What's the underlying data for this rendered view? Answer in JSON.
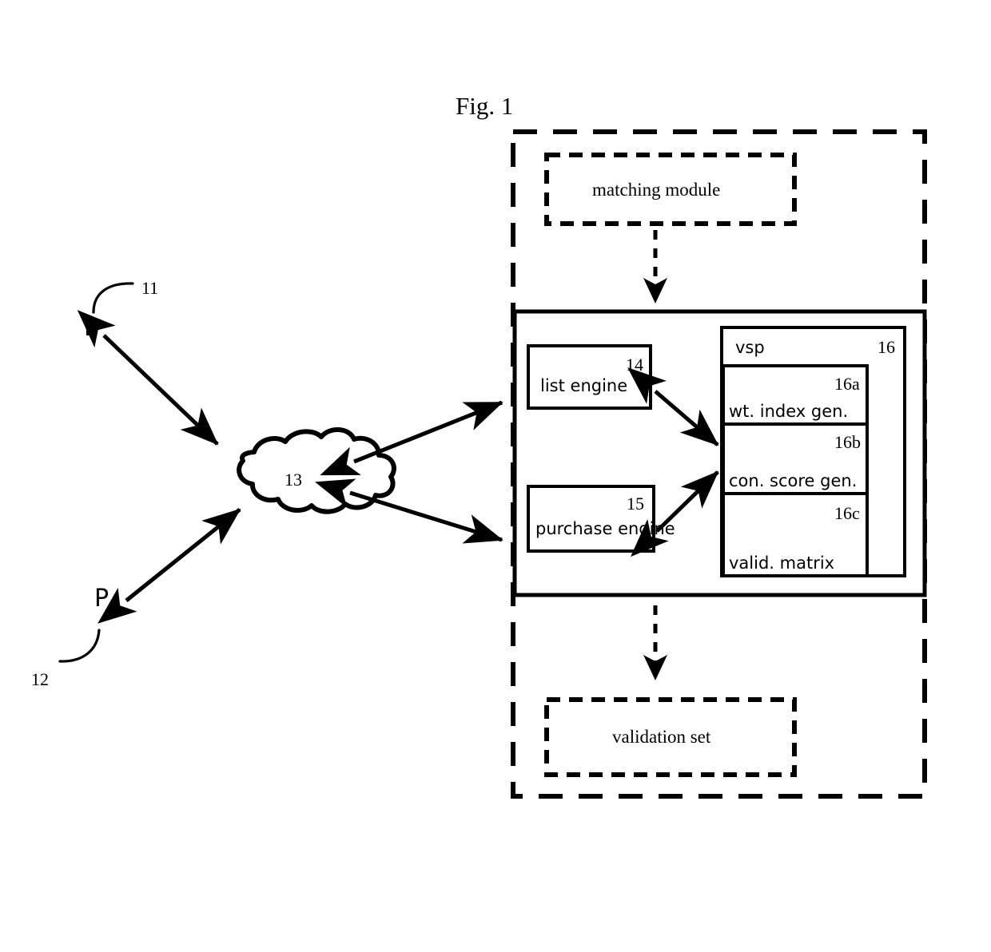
{
  "figure": {
    "title": "Fig. 1"
  },
  "external_nodes": [
    {
      "letter": "L",
      "ref": "11"
    },
    {
      "letter": "P",
      "ref": "12"
    }
  ],
  "network": {
    "label": "13",
    "shape": "cloud"
  },
  "system": {
    "matching_module": {
      "label": "matching module",
      "style": "dashed"
    },
    "validation_set": {
      "label": "validation set",
      "style": "dashed"
    }
  },
  "engines": [
    {
      "label": "list engine",
      "ref": "14"
    },
    {
      "label": "purchase engine",
      "ref": "15"
    }
  ],
  "vsp": {
    "label": "vsp",
    "ref": "16",
    "components": [
      {
        "label": "wt. index gen.",
        "ref": "16a"
      },
      {
        "label": "con. score gen.",
        "ref": "16b"
      },
      {
        "label": "valid. matrix",
        "ref": "16c"
      }
    ]
  },
  "colors": {
    "stroke": "#000000",
    "background": "#ffffff"
  }
}
